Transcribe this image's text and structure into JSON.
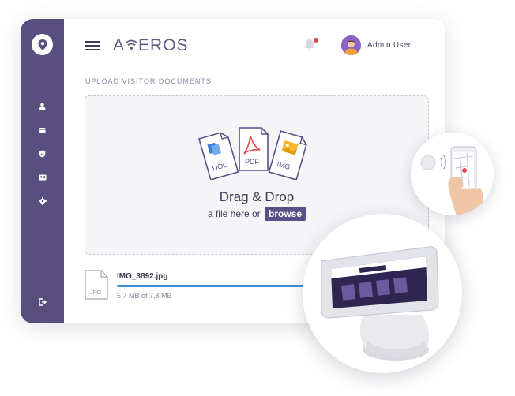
{
  "app": {
    "brand": "A EROS",
    "brand_prefix": "A",
    "brand_suffix": "EROS",
    "accent_color": "#584f7f",
    "progress_color": "#3b8fd9"
  },
  "header": {
    "user_name": "Admin User",
    "has_notification": true
  },
  "sidebar": {
    "items": [
      {
        "name": "user-icon"
      },
      {
        "name": "visitors-icon"
      },
      {
        "name": "shield-icon"
      },
      {
        "name": "badge-icon"
      },
      {
        "name": "gear-icon"
      },
      {
        "name": "logout-icon"
      }
    ]
  },
  "upload": {
    "section_title": "UPLOAD VISITOR DOCUMENTS",
    "drag_title": "Drag & Drop",
    "drag_sub": "a file here or",
    "browse_label": "browse",
    "doc_types": [
      "DOC",
      "PDF",
      "IMG"
    ]
  },
  "file": {
    "name": "IMG_3892.jpg",
    "type_label": "JPG",
    "size_text": "5,7 MB of 7,8 MB",
    "progress": 0.73
  }
}
